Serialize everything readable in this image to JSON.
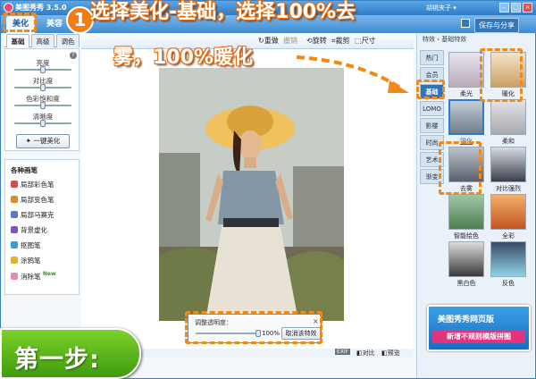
{
  "app": {
    "title": "美图秀秀 3.5.0",
    "user": "胡桃夹子 ▾"
  },
  "main_tabs": [
    {
      "label": "美化"
    },
    {
      "label": "美容"
    }
  ],
  "tabs_right": {
    "save": "保存与分享"
  },
  "toolbar": {
    "redo": "重做",
    "rotate": "旋转",
    "crop": "裁剪",
    "size": "尺寸",
    "undo": "撤销"
  },
  "left_panel": {
    "subtabs": [
      {
        "label": "基础"
      },
      {
        "label": "高级"
      },
      {
        "label": "调色"
      }
    ],
    "adjust": [
      {
        "label": "亮度"
      },
      {
        "label": "对比度"
      },
      {
        "label": "色彩饱和度"
      },
      {
        "label": "清晰度"
      }
    ],
    "adjust_levels": [
      0.5,
      0.5,
      0.5,
      0.5
    ],
    "beautify_button": "一键美化",
    "pens_title": "各种画笔",
    "pens": [
      {
        "label": "局部彩色笔",
        "color": "#d94a4a"
      },
      {
        "label": "局部变色笔",
        "color": "#e08a2a"
      },
      {
        "label": "局部马赛克",
        "color": "#5a7abf"
      },
      {
        "label": "背景虚化",
        "color": "#7a55c4"
      },
      {
        "label": "抠图笔",
        "color": "#3a9bd8"
      },
      {
        "label": "涂鸦笔",
        "color": "#e5b22b"
      },
      {
        "label": "消除笔",
        "color": "#e78ab0"
      }
    ],
    "new_badge": "New"
  },
  "transparency": {
    "label": "调整透明度：",
    "value_label": "100%",
    "level": 1.0,
    "cancel": "取消该特效",
    "close": "×"
  },
  "status": {
    "exif": "EXIF",
    "compare": "对比",
    "preview": "预览"
  },
  "right_panel": {
    "header": "特效 ‹ 基础特效",
    "categories": [
      {
        "label": "热门"
      },
      {
        "label": "会员"
      },
      {
        "label": "基础"
      },
      {
        "label": "LOMO"
      },
      {
        "label": "影楼"
      },
      {
        "label": "时尚"
      },
      {
        "label": "艺术"
      },
      {
        "label": "渐变"
      }
    ],
    "effects": [
      {
        "label": "柔光"
      },
      {
        "label": "暖化"
      },
      {
        "label": "锐化"
      },
      {
        "label": "柔和"
      },
      {
        "label": "去雾"
      },
      {
        "label": "对比强烈"
      },
      {
        "label": "智能绘色"
      },
      {
        "label": "全彩"
      },
      {
        "label": "黑白色"
      },
      {
        "label": "反色"
      }
    ]
  },
  "ad": {
    "line1": "美图秀秀网页版",
    "line2": "新增不规则模版拼图"
  },
  "annotation": {
    "number": "1",
    "line1": "选择美化-基础，选择100%去",
    "line2": "雾，100%暖化",
    "step": "第一步:"
  },
  "colors": {
    "accent": "#2f7bc6",
    "highlight": "#f08a14",
    "step": "#5cb51c"
  }
}
